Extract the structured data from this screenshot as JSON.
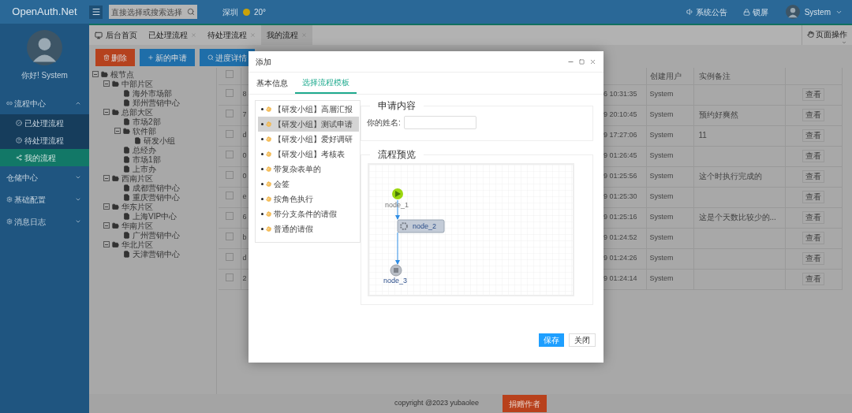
{
  "top_bar": {
    "logo": "OpenAuth.Net",
    "search": {
      "placeholder": "直接选择或搜索选择"
    },
    "weather": {
      "city": "深圳",
      "temperature": "20°"
    },
    "notice": "系统公告",
    "lock": "锁屏",
    "user": "System"
  },
  "sidebar": {
    "greeting": "你好! System",
    "menu": [
      {
        "label": "流程中心",
        "expanded": true,
        "children": [
          {
            "label": "已处理流程",
            "selected": false
          },
          {
            "label": "待处理流程",
            "selected": false
          },
          {
            "label": "我的流程",
            "selected": true
          }
        ]
      },
      {
        "label": "仓储中心",
        "expanded": false
      },
      {
        "label": "基础配置",
        "expanded": false
      },
      {
        "label": "消息日志",
        "expanded": false
      }
    ]
  },
  "tabs": [
    {
      "label": "后台首页",
      "selected": false,
      "closable": false
    },
    {
      "label": "已处理流程",
      "selected": false,
      "closable": true
    },
    {
      "label": "待处理流程",
      "selected": false,
      "closable": true
    },
    {
      "label": "我的流程",
      "selected": true,
      "closable": true
    }
  ],
  "page_menu": "页面操作",
  "toolbar": [
    {
      "label": "删除",
      "kind": "danger"
    },
    {
      "label": "新的申请",
      "kind": "add"
    },
    {
      "label": "进度详情",
      "kind": "search"
    }
  ],
  "tree": {
    "label": "根节点",
    "expanded": true,
    "children": [
      {
        "label": "中部片区",
        "expanded": true,
        "children": [
          {
            "label": "海外市场部"
          },
          {
            "label": "郑州营销中心"
          }
        ]
      },
      {
        "label": "总部大区",
        "expanded": true,
        "children": [
          {
            "label": "市场2部"
          },
          {
            "label": "软件部",
            "expanded": true,
            "children": [
              {
                "label": "研发小组"
              }
            ]
          },
          {
            "label": "总经办"
          },
          {
            "label": "市场1部"
          },
          {
            "label": "上市办"
          }
        ]
      },
      {
        "label": "西南片区",
        "expanded": true,
        "children": [
          {
            "label": "成都营销中心"
          },
          {
            "label": "重庆营销中心"
          }
        ]
      },
      {
        "label": "华东片区",
        "expanded": true,
        "children": [
          {
            "label": "上海VIP中心"
          }
        ]
      },
      {
        "label": "华南片区",
        "expanded": true,
        "children": [
          {
            "label": "广州营销中心"
          }
        ]
      },
      {
        "label": "华北片区",
        "expanded": true,
        "children": [
          {
            "label": "天津营销中心"
          }
        ]
      }
    ]
  },
  "table": {
    "all_checked": false,
    "columns": [
      "创建用户",
      "实例备注"
    ],
    "rows": [
      {
        "column_1": "8",
        "time": "6 10:31:35",
        "user": "System",
        "action": "查看",
        "checked": false
      },
      {
        "column_1": "7",
        "time": "9 20:10:45",
        "user": "System",
        "note": "预约好爽然",
        "action": "查看",
        "checked": false
      },
      {
        "column_1": "d",
        "time": "9 17:27:06",
        "user": "System",
        "note": "11",
        "action": "查看",
        "checked": false
      },
      {
        "column_1": "0",
        "time": "9 01:26:45",
        "user": "System",
        "action": "查看",
        "checked": false
      },
      {
        "column_1": "0",
        "time": "9 01:25:56",
        "user": "System",
        "note": "这个时执行完成的",
        "action": "查看",
        "checked": false
      },
      {
        "column_1": "e",
        "time": "9 01:25:30",
        "user": "System",
        "action": "查看",
        "checked": false
      },
      {
        "column_1": "6",
        "time": "9 01:25:16",
        "user": "System",
        "note": "这是个天数比较少的...",
        "action": "查看",
        "checked": false
      },
      {
        "column_1": "b",
        "time": "9 01:24:52",
        "user": "System",
        "action": "查看",
        "checked": false
      },
      {
        "column_1": "d",
        "time": "9 01:24:26",
        "user": "System",
        "action": "查看",
        "checked": false
      },
      {
        "column_1": "2",
        "time": "9 01:24:14",
        "user": "System",
        "action": "查看",
        "checked": false
      }
    ]
  },
  "dialog": {
    "title": "添加",
    "tabs": [
      {
        "label": "基本信息",
        "selected": false
      },
      {
        "label": "选择流程模板",
        "selected": true
      }
    ],
    "templates": [
      {
        "label": "【研发小组】高層汇报",
        "selected": false
      },
      {
        "label": "【研发小组】测试申请",
        "selected": true
      },
      {
        "label": "【研发小组】爱好调研",
        "selected": false
      },
      {
        "label": "【研发小组】考核表",
        "selected": false
      },
      {
        "label": "带复杂表单的",
        "selected": false
      },
      {
        "label": "会签",
        "selected": false
      },
      {
        "label": "按角色执行",
        "selected": false
      },
      {
        "label": "带分支条件的请假",
        "selected": false
      },
      {
        "label": "普通的请假",
        "selected": false
      }
    ],
    "form": {
      "legend": "申请内容",
      "field_label": "你的姓名:"
    },
    "preview": {
      "legend": "流程预览",
      "nodes": [
        {
          "label": "node_1",
          "kind": "start"
        },
        {
          "label": "node_2",
          "kind": "task"
        },
        {
          "label": "node_3",
          "kind": "end"
        }
      ]
    },
    "buttons": [
      {
        "label": "保存",
        "kind": "primary"
      },
      {
        "label": "关闭",
        "kind": "default"
      }
    ]
  },
  "footer": {
    "copyright": "copyright @2023 yubaolee",
    "donate": "捐赠作者"
  }
}
